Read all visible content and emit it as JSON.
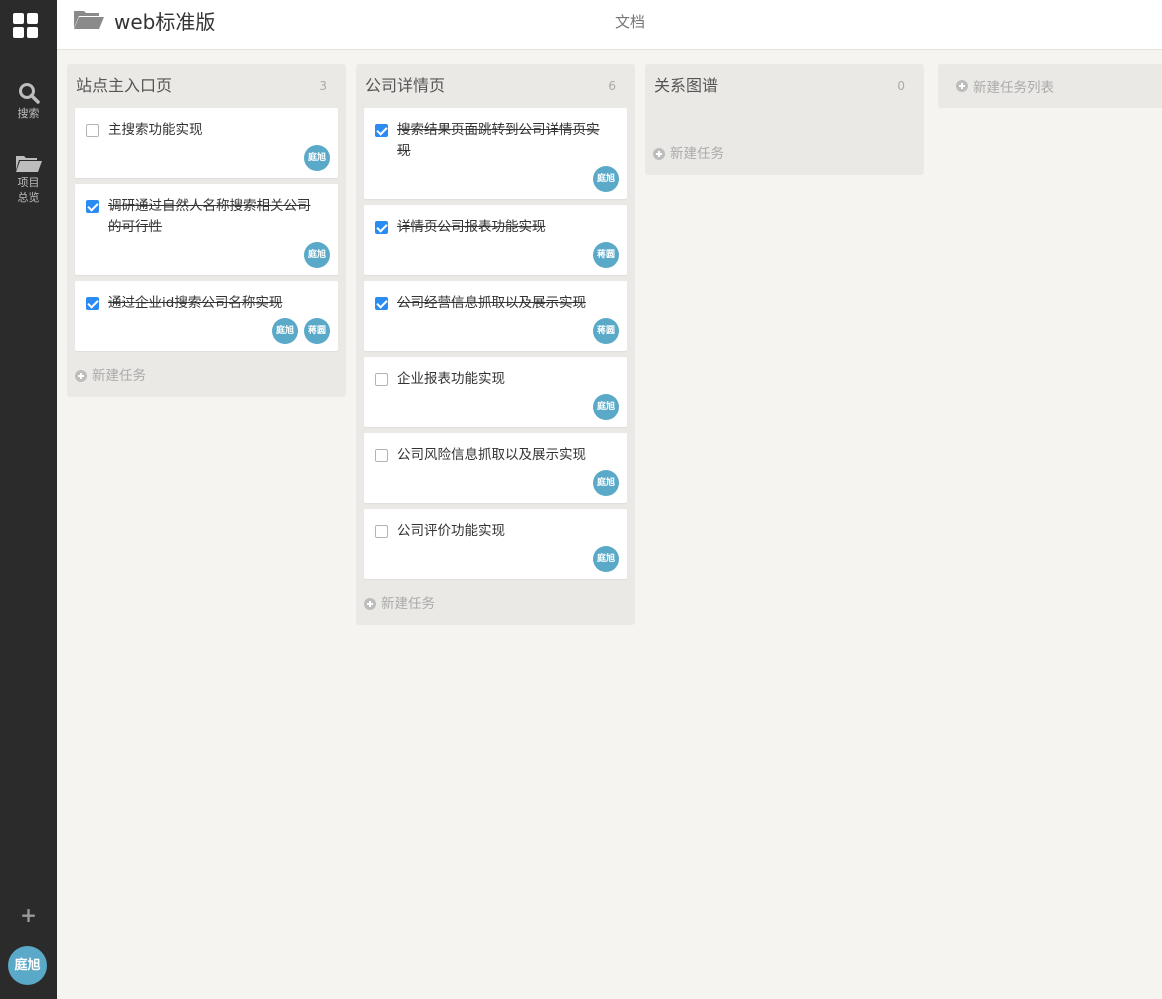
{
  "sidebar": {
    "logo_icon": "grid-icon",
    "search_label": "搜索",
    "overview_label_line1": "项目",
    "overview_label_line2": "总览",
    "add_label": "+",
    "user_avatar": "庭旭"
  },
  "header": {
    "project_title": "web标准版",
    "tab_docs": "文档"
  },
  "columns": [
    {
      "title": "站点主入口页",
      "count": "3",
      "new_task_label": "新建任务",
      "cards": [
        {
          "text": "主搜索功能实现",
          "done": false,
          "assignees": [
            "庭旭"
          ]
        },
        {
          "text": "调研通过自然人名称搜索相关公司的可行性",
          "done": true,
          "assignees": [
            "庭旭"
          ]
        },
        {
          "text": "通过企业id搜索公司名称实现",
          "done": true,
          "assignees": [
            "庭旭",
            "蒋圆"
          ]
        }
      ]
    },
    {
      "title": "公司详情页",
      "count": "6",
      "new_task_label": "新建任务",
      "cards": [
        {
          "text": "搜索结果页面跳转到公司详情页实现",
          "done": true,
          "assignees": [
            "庭旭"
          ]
        },
        {
          "text": "详情页公司报表功能实现",
          "done": true,
          "assignees": [
            "蒋圆"
          ]
        },
        {
          "text": "公司经营信息抓取以及展示实现",
          "done": true,
          "assignees": [
            "蒋圆"
          ]
        },
        {
          "text": "企业报表功能实现",
          "done": false,
          "assignees": [
            "庭旭"
          ]
        },
        {
          "text": "公司风险信息抓取以及展示实现",
          "done": false,
          "assignees": [
            "庭旭"
          ]
        },
        {
          "text": "公司评价功能实现",
          "done": false,
          "assignees": [
            "庭旭"
          ]
        }
      ]
    },
    {
      "title": "关系图谱",
      "count": "0",
      "new_task_label": "新建任务",
      "cards": []
    }
  ],
  "new_list_label": "新建任务列表",
  "colors": {
    "sidebar_bg": "#2b2b2b",
    "avatar_bg": "#5aa9c8",
    "checkbox_checked": "#2a8cf2",
    "column_bg": "#ebe9e5",
    "page_bg": "#f5f4f0"
  }
}
